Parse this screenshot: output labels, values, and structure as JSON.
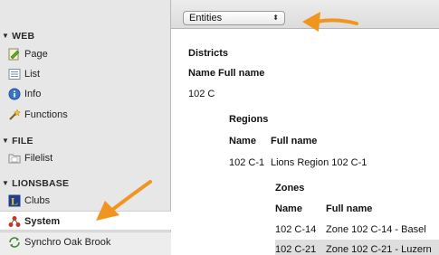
{
  "accent_color": "#f0951e",
  "sidebar": {
    "sections": [
      {
        "label": "WEB",
        "items": [
          {
            "label": "Page",
            "icon": "page-edit-icon"
          },
          {
            "label": "List",
            "icon": "list-icon"
          },
          {
            "label": "Info",
            "icon": "info-icon"
          },
          {
            "label": "Functions",
            "icon": "wand-icon"
          }
        ]
      },
      {
        "label": "FILE",
        "items": [
          {
            "label": "Filelist",
            "icon": "folder-icon"
          }
        ]
      },
      {
        "label": "LIONSBASE",
        "items": [
          {
            "label": "Clubs",
            "icon": "lions-logo-icon"
          },
          {
            "label": "System",
            "icon": "hierarchy-icon"
          },
          {
            "label": "Synchro Oak Brook",
            "icon": "sync-icon"
          }
        ]
      }
    ]
  },
  "toolbar": {
    "entity_select": {
      "value": "Entities",
      "arrow": "⌃⌄"
    }
  },
  "main": {
    "districts": {
      "title": "Districts",
      "col_name": "Name",
      "col_full": "Full name",
      "row": {
        "name": "102 C",
        "full": ""
      }
    },
    "regions": {
      "title": "Regions",
      "col_name": "Name",
      "col_full": "Full name",
      "row": {
        "name": "102 C-1",
        "full": "Lions Region 102 C-1"
      }
    },
    "zones": {
      "title": "Zones",
      "col_name": "Name",
      "col_full": "Full name",
      "rows": [
        {
          "name": "102 C-14",
          "full": "Zone 102 C-14 - Basel"
        },
        {
          "name": "102 C-21",
          "full": "Zone 102 C-21 - Luzern"
        }
      ]
    }
  }
}
